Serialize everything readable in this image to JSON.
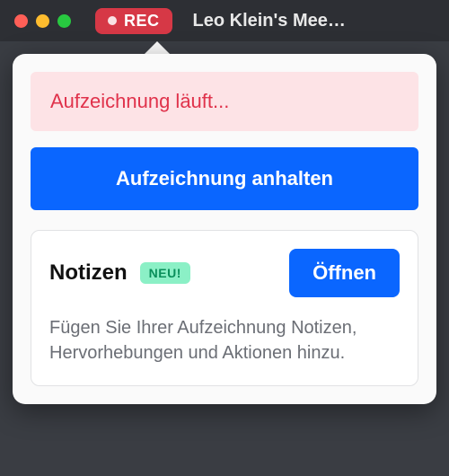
{
  "titlebar": {
    "rec_label": "REC",
    "window_title": "Leo Klein's Mee…"
  },
  "popover": {
    "status_text": "Aufzeichnung läuft...",
    "pause_button_label": "Aufzeichnung anhalten",
    "notes": {
      "title": "Notizen",
      "new_badge": "NEU!",
      "open_button_label": "Öffnen",
      "description": "Fügen Sie Ihrer Aufzeichnung Notizen, Hervorhebungen und Aktionen hinzu."
    }
  }
}
